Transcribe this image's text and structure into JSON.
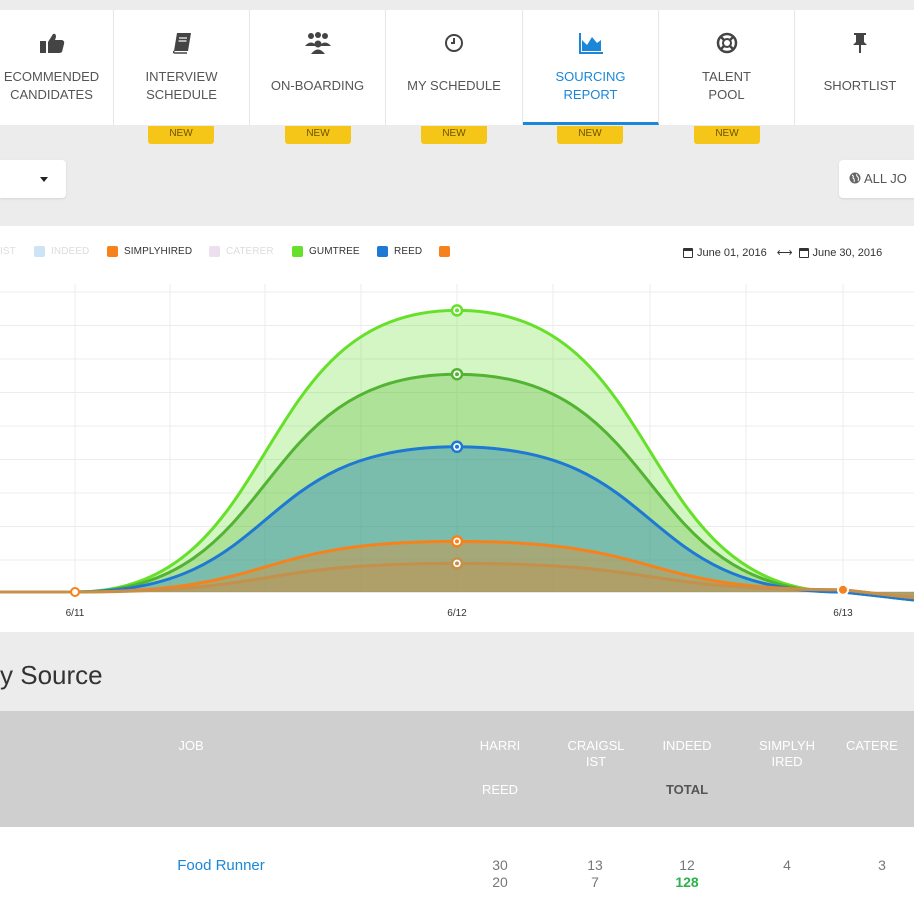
{
  "nav": {
    "tabs": [
      {
        "label": "RECOMMENDED CANDIDATES",
        "line1": "ECOMMENDED",
        "line2": "CANDIDATES",
        "icon": "thumbs-up-icon",
        "badge": "NEW"
      },
      {
        "label": "INTERVIEW SCHEDULE",
        "line1": "INTERVIEW",
        "line2": "SCHEDULE",
        "icon": "book-icon",
        "badge": "NEW"
      },
      {
        "label": "ON-BOARDING",
        "line1": "ON-BOARDING",
        "line2": "",
        "icon": "group-icon",
        "badge": "NEW"
      },
      {
        "label": "MY SCHEDULE",
        "line1": "MY SCHEDULE",
        "line2": "",
        "icon": "clock-icon",
        "badge": "NEW"
      },
      {
        "label": "SOURCING REPORT",
        "line1": "SOURCING",
        "line2": "REPORT",
        "icon": "area-chart-icon",
        "badge": "NEW",
        "active": true
      },
      {
        "label": "TALENT POOL",
        "line1": "TALENT",
        "line2": "POOL",
        "icon": "lifebuoy-icon",
        "badge": "NEW"
      },
      {
        "label": "SHORTLIST",
        "line1": "SHORTLIST",
        "line2": "",
        "icon": "pin-icon",
        "badge": ""
      }
    ]
  },
  "filters": {
    "all_jobs_label": "ALL JO"
  },
  "legend": {
    "items": [
      {
        "label": "IST",
        "color": "#f2f2f2",
        "faded": true
      },
      {
        "label": "INDEED",
        "color": "#cfe3f7",
        "faded": true
      },
      {
        "label": "SIMPLYHIRED",
        "color": "#f7821b",
        "faded": false
      },
      {
        "label": "CATERER",
        "color": "#ecdff0",
        "faded": true
      },
      {
        "label": "GUMTREE",
        "color": "#66e02a",
        "faded": false
      },
      {
        "label": "REED",
        "color": "#1e78d4",
        "faded": false
      },
      {
        "label": "",
        "color": "#f7821b",
        "faded": false
      }
    ]
  },
  "date_range": {
    "start": "June 01, 2016",
    "end": "June 30, 2016"
  },
  "chart_data": {
    "type": "area",
    "categories": [
      "6/11",
      "6/12",
      "6/13"
    ],
    "series": [
      {
        "name": "GUMTREE",
        "values": [
          0,
          128,
          0
        ],
        "color": "#66e02a"
      },
      {
        "values": [
          0,
          99,
          0
        ],
        "color": "#52b432"
      },
      {
        "name": "REED",
        "values": [
          0,
          66,
          0
        ],
        "color": "#1e78d4"
      },
      {
        "values": [
          0,
          23,
          1
        ],
        "color": "#f7821b"
      },
      {
        "values": [
          0,
          13,
          1
        ],
        "color": "#c4904a"
      }
    ],
    "ylim": [
      0,
      140
    ],
    "grid": true
  },
  "section": {
    "title": "y Source"
  },
  "table": {
    "headers": {
      "job": "JOB",
      "harri": "HARRI",
      "reed": "REED",
      "craigslist_1": "CRAIGSL",
      "craigslist_2": "IST",
      "indeed": "INDEED",
      "total": "TOTAL",
      "simplyhired_1": "SIMPLYH",
      "simplyhired_2": "IRED",
      "caterer": "CATERE"
    },
    "rows": [
      {
        "job": "Food Runner",
        "harri": "30",
        "reed": "20",
        "craigslist": "13",
        "craigslist_2": "7",
        "indeed": "12",
        "total": "128",
        "simplyhired": "4",
        "caterer": "3"
      }
    ]
  }
}
